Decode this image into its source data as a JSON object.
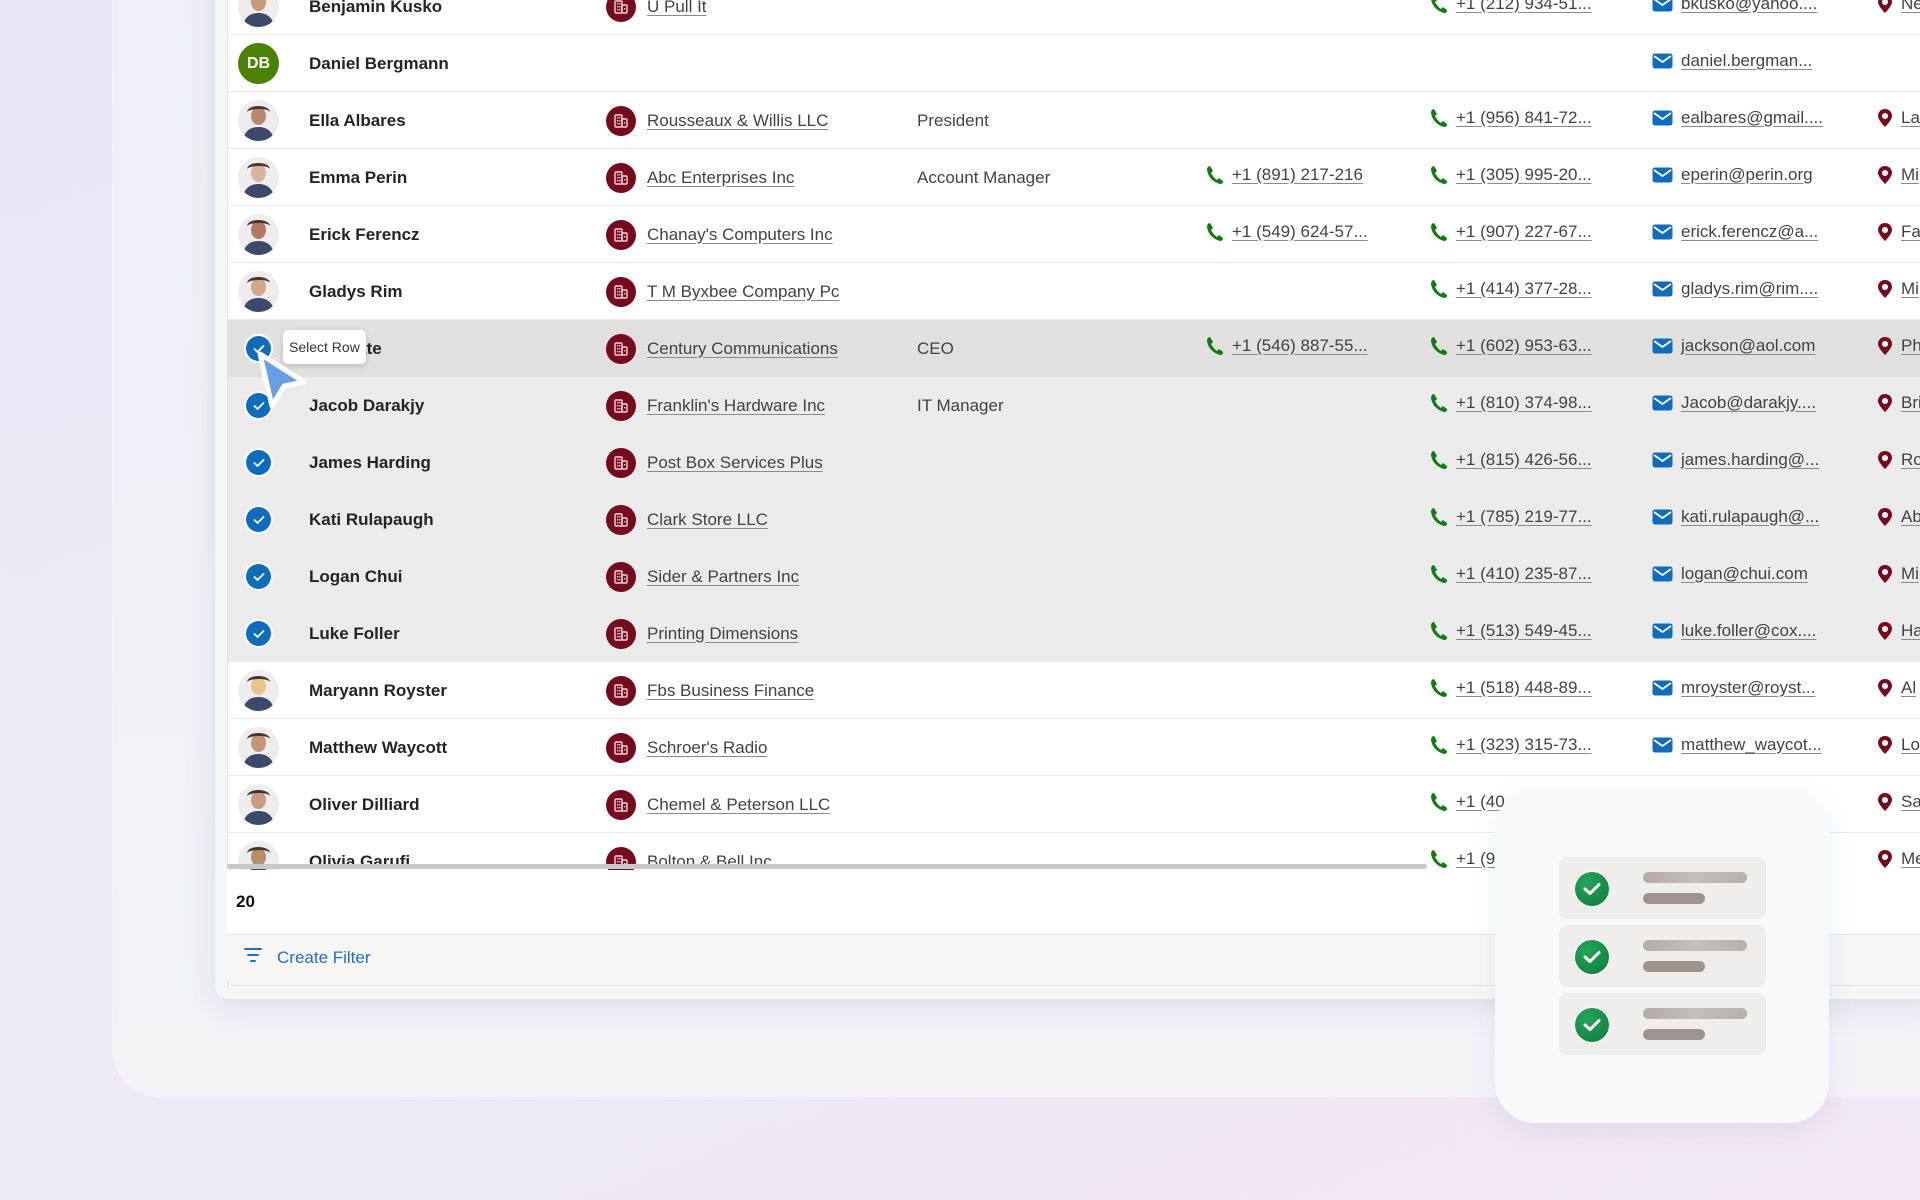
{
  "grid": {
    "rows": [
      {
        "state": "normal",
        "avatar": {
          "type": "photo",
          "tone": "#c99a7a"
        },
        "name": "Benjamin Kusko",
        "company": "U Pull It",
        "job_title": "",
        "business_phone": "",
        "mobile_phone": "+1 (212) 934-51...",
        "email": "bkusko@yahoo....",
        "location": "Ne"
      },
      {
        "state": "normal",
        "avatar": {
          "type": "initials",
          "initials": "DB",
          "color": "#498205"
        },
        "name": "Daniel Bergmann",
        "company": "",
        "job_title": "",
        "business_phone": "",
        "mobile_phone": "",
        "email": "daniel.bergman...",
        "location": ""
      },
      {
        "state": "normal",
        "avatar": {
          "type": "photo",
          "tone": "#b58a6e"
        },
        "name": "Ella Albares",
        "company": "Rousseaux & Willis LLC",
        "job_title": "President",
        "business_phone": "",
        "mobile_phone": "+1 (956) 841-72...",
        "email": "ealbares@gmail....",
        "location": "La"
      },
      {
        "state": "normal",
        "avatar": {
          "type": "photo",
          "tone": "#d9b39a"
        },
        "name": "Emma Perin",
        "company": "Abc Enterprises Inc",
        "job_title": "Account Manager",
        "business_phone": "+1 (891) 217-216",
        "mobile_phone": "+1 (305) 995-20...",
        "email": "eperin@perin.org",
        "location": "Mi"
      },
      {
        "state": "normal",
        "avatar": {
          "type": "photo",
          "tone": "#b27a60"
        },
        "name": "Erick Ferencz",
        "company": "Chanay's Computers Inc",
        "job_title": "",
        "business_phone": "+1 (549) 624-57...",
        "mobile_phone": "+1 (907) 227-67...",
        "email": "erick.ferencz@a...",
        "location": "Fa"
      },
      {
        "state": "normal",
        "avatar": {
          "type": "photo",
          "tone": "#d2a78c"
        },
        "name": "Gladys Rim",
        "company": "T M Byxbee Company Pc",
        "job_title": "",
        "business_phone": "",
        "mobile_phone": "+1 (414) 377-28...",
        "email": "gladys.rim@rim....",
        "location": "Mi"
      },
      {
        "state": "hovered",
        "avatar": {
          "type": "check"
        },
        "name": "Poquette",
        "company": "Century Communications",
        "job_title": "CEO",
        "business_phone": "+1 (546) 887-55...",
        "mobile_phone": "+1 (602) 953-63...",
        "email": "jackson@aol.com",
        "location": "Ph"
      },
      {
        "state": "selected",
        "avatar": {
          "type": "check"
        },
        "name": "Jacob Darakjy",
        "company": "Franklin's Hardware Inc",
        "job_title": "IT Manager",
        "business_phone": "",
        "mobile_phone": "+1 (810) 374-98...",
        "email": "Jacob@darakjy....",
        "location": "Bri"
      },
      {
        "state": "selected",
        "avatar": {
          "type": "check"
        },
        "name": "James Harding",
        "company": "Post Box Services Plus",
        "job_title": "",
        "business_phone": "",
        "mobile_phone": "+1 (815) 426-56...",
        "email": "james.harding@...",
        "location": "Ro"
      },
      {
        "state": "selected",
        "avatar": {
          "type": "check"
        },
        "name": "Kati Rulapaugh",
        "company": "Clark Store LLC",
        "job_title": "",
        "business_phone": "",
        "mobile_phone": "+1 (785) 219-77...",
        "email": "kati.rulapaugh@...",
        "location": "Ab"
      },
      {
        "state": "selected",
        "avatar": {
          "type": "check"
        },
        "name": "Logan Chui",
        "company": "Sider & Partners Inc",
        "job_title": "",
        "business_phone": "",
        "mobile_phone": "+1 (410) 235-87...",
        "email": "logan@chui.com",
        "location": "Mi"
      },
      {
        "state": "selected",
        "avatar": {
          "type": "check"
        },
        "name": "Luke Foller",
        "company": "Printing Dimensions",
        "job_title": "",
        "business_phone": "",
        "mobile_phone": "+1 (513) 549-45...",
        "email": "luke.foller@cox....",
        "location": "Ha"
      },
      {
        "state": "normal",
        "avatar": {
          "type": "photo",
          "tone": "#e8c48a"
        },
        "name": "Maryann Royster",
        "company": "Fbs Business Finance",
        "job_title": "",
        "business_phone": "",
        "mobile_phone": "+1 (518) 448-89...",
        "email": "mroyster@royst...",
        "location": "Al"
      },
      {
        "state": "normal",
        "avatar": {
          "type": "photo",
          "tone": "#c49479"
        },
        "name": "Matthew Waycott",
        "company": "Schroer's Radio",
        "job_title": "",
        "business_phone": "",
        "mobile_phone": "+1 (323) 315-73...",
        "email": "matthew_waycot...",
        "location": "Lo"
      },
      {
        "state": "normal",
        "avatar": {
          "type": "photo",
          "tone": "#c89c80"
        },
        "name": "Oliver Dilliard",
        "company": "Chemel & Peterson LLC",
        "job_title": "",
        "business_phone": "",
        "mobile_phone": "+1 (40",
        "email": "",
        "location": "Sa"
      },
      {
        "state": "normal",
        "avatar": {
          "type": "photo",
          "tone": "#b98c6a"
        },
        "name": "Olivia Garufi",
        "company": "Bolton & Bell Inc",
        "job_title": "",
        "business_phone": "",
        "mobile_phone": "+1 (9",
        "email": "",
        "location": "Me"
      }
    ],
    "record_count": "20",
    "tooltip": "Select Row"
  },
  "footer": {
    "create_filter_label": "Create Filter",
    "filter_icon": "filter-lines-icon"
  },
  "icons": {
    "company": "building-icon",
    "phone": "phone-icon",
    "email": "mail-icon",
    "location": "location-pin-icon",
    "selected": "checkmark-circle-icon"
  },
  "colors": {
    "accent": "#0f6cbd",
    "company_badge": "#750b1c",
    "phone": "#107c10",
    "email": "#0f6cbd",
    "location": "#750b1c",
    "initials_avatar": "#498205",
    "selected_row": "#ebebeb",
    "hovered_row": "#e1e0df",
    "check_green": "#1a8f47"
  },
  "feature_card": {
    "items": [
      {
        "done": true
      },
      {
        "done": true
      },
      {
        "done": true
      }
    ]
  }
}
